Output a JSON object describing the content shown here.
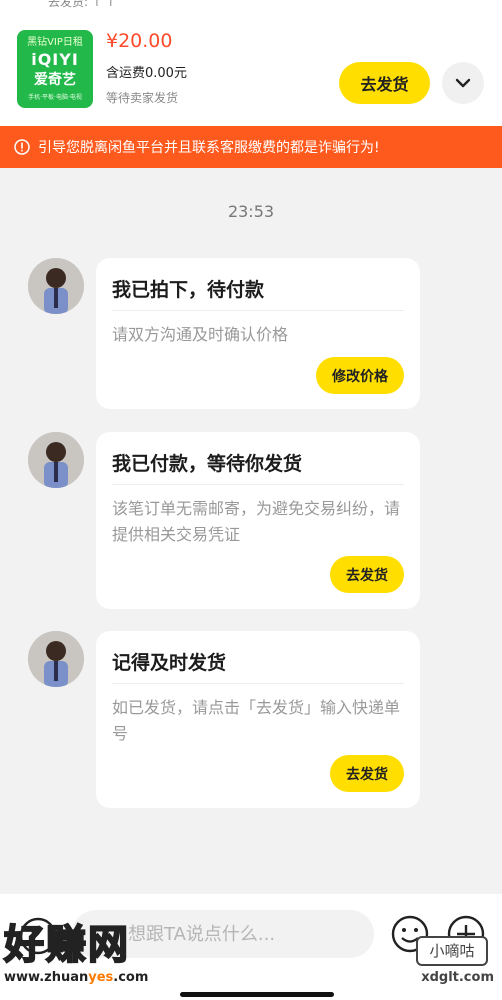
{
  "header_cut_text": "去发货: ↑ ↑",
  "order": {
    "thumb_line1": "黑钻VIP日租",
    "thumb_brand": "iQIYI",
    "thumb_brand_cn": "爱奇艺",
    "thumb_line4": "手机·平板·电脑·电视",
    "price": "¥20.00",
    "shipping": "含运费0.00元",
    "status": "等待卖家发货",
    "ship_button": "去发货"
  },
  "warning": {
    "text": "引导您脱离闲鱼平台并且联系客服缴费的都是诈骗行为!"
  },
  "time": "23:53",
  "messages": [
    {
      "title": "我已拍下，待付款",
      "desc": "请双方沟通及时确认价格",
      "button": "修改价格"
    },
    {
      "title": "我已付款，等待你发货",
      "desc": "该笔订单无需邮寄，为避免交易纠纷，请提供相关交易凭证",
      "button": "去发货"
    },
    {
      "title": "记得及时发货",
      "desc": "如已发货，请点击「去发货」输入快递单号",
      "button": "去发货"
    }
  ],
  "input": {
    "placeholder": "想跟TA说点什么..."
  },
  "watermark": {
    "big": "好赚网",
    "url_pre": "www.zhuan",
    "url_accent": "yes",
    "url_post": ".com",
    "box": "小嘀咕",
    "site": "xdglt.com"
  },
  "colors": {
    "accent": "#ffde00",
    "warning": "#ff5a1e",
    "price": "#ff4a2b"
  }
}
